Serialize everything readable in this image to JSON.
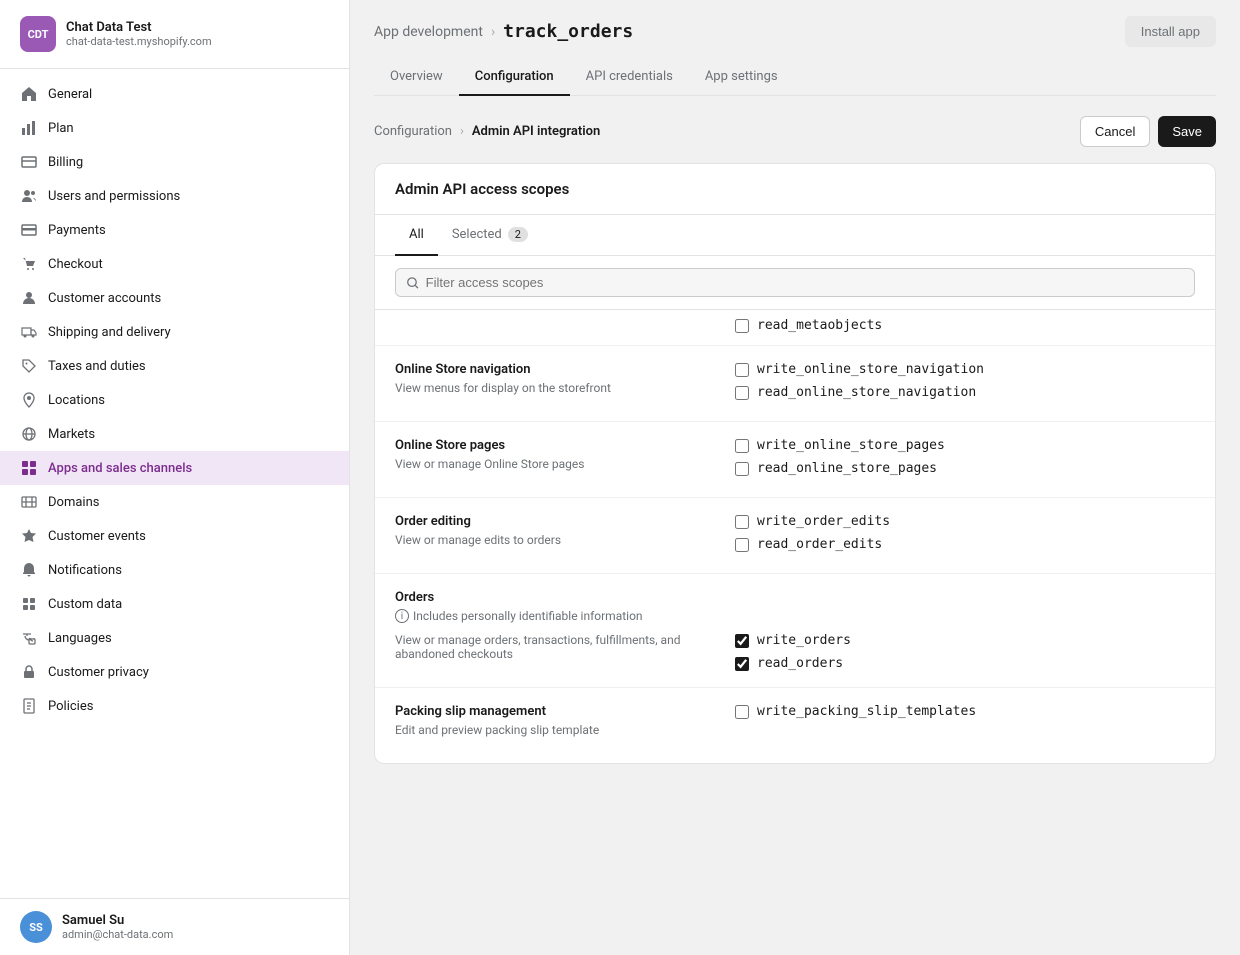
{
  "sidebar": {
    "store": {
      "initials": "CDT",
      "name": "Chat Data Test",
      "url": "chat-data-test.myshopify.com"
    },
    "nav_items": [
      {
        "id": "general",
        "label": "General",
        "icon": "home"
      },
      {
        "id": "plan",
        "label": "Plan",
        "icon": "chart"
      },
      {
        "id": "billing",
        "label": "Billing",
        "icon": "billing"
      },
      {
        "id": "users",
        "label": "Users and permissions",
        "icon": "users"
      },
      {
        "id": "payments",
        "label": "Payments",
        "icon": "payments"
      },
      {
        "id": "checkout",
        "label": "Checkout",
        "icon": "cart"
      },
      {
        "id": "customer-accounts",
        "label": "Customer accounts",
        "icon": "person"
      },
      {
        "id": "shipping",
        "label": "Shipping and delivery",
        "icon": "truck"
      },
      {
        "id": "taxes",
        "label": "Taxes and duties",
        "icon": "tag"
      },
      {
        "id": "locations",
        "label": "Locations",
        "icon": "pin"
      },
      {
        "id": "markets",
        "label": "Markets",
        "icon": "globe"
      },
      {
        "id": "apps",
        "label": "Apps and sales channels",
        "icon": "apps",
        "active": true
      },
      {
        "id": "domains",
        "label": "Domains",
        "icon": "domain"
      },
      {
        "id": "customer-events",
        "label": "Customer events",
        "icon": "events"
      },
      {
        "id": "notifications",
        "label": "Notifications",
        "icon": "bell"
      },
      {
        "id": "custom-data",
        "label": "Custom data",
        "icon": "data"
      },
      {
        "id": "languages",
        "label": "Languages",
        "icon": "language"
      },
      {
        "id": "customer-privacy",
        "label": "Customer privacy",
        "icon": "lock"
      },
      {
        "id": "policies",
        "label": "Policies",
        "icon": "doc"
      }
    ],
    "user": {
      "initials": "SS",
      "name": "Samuel Su",
      "email": "admin@chat-data.com"
    }
  },
  "header": {
    "breadcrumb_parent": "App development",
    "breadcrumb_current": "track_orders",
    "install_button": "Install app"
  },
  "tabs": [
    {
      "id": "overview",
      "label": "Overview"
    },
    {
      "id": "configuration",
      "label": "Configuration",
      "active": true
    },
    {
      "id": "api-credentials",
      "label": "API credentials"
    },
    {
      "id": "app-settings",
      "label": "App settings"
    }
  ],
  "sub_breadcrumb": {
    "parent": "Configuration",
    "current": "Admin API integration"
  },
  "actions": {
    "cancel": "Cancel",
    "save": "Save"
  },
  "card": {
    "title": "Admin API access scopes",
    "scope_tabs": [
      {
        "id": "all",
        "label": "All",
        "active": true
      },
      {
        "id": "selected",
        "label": "Selected",
        "badge": "2"
      }
    ],
    "filter_placeholder": "Filter access scopes",
    "sections": [
      {
        "id": "top-partial",
        "items_right": [
          {
            "id": "read_metaobjects",
            "label": "read_metaobjects",
            "checked": false
          }
        ]
      },
      {
        "id": "online-store-nav",
        "title": "Online Store navigation",
        "desc": "View menus for display on the storefront",
        "items": [
          {
            "id": "write_online_store_navigation",
            "label": "write_online_store_navigation",
            "checked": false
          },
          {
            "id": "read_online_store_navigation",
            "label": "read_online_store_navigation",
            "checked": false
          }
        ]
      },
      {
        "id": "online-store-pages",
        "title": "Online Store pages",
        "desc": "View or manage Online Store pages",
        "items": [
          {
            "id": "write_online_store_pages",
            "label": "write_online_store_pages",
            "checked": false
          },
          {
            "id": "read_online_store_pages",
            "label": "read_online_store_pages",
            "checked": false
          }
        ]
      },
      {
        "id": "order-editing",
        "title": "Order editing",
        "desc": "View or manage edits to orders",
        "items": [
          {
            "id": "write_order_edits",
            "label": "write_order_edits",
            "checked": false
          },
          {
            "id": "read_order_edits",
            "label": "read_order_edits",
            "checked": false
          }
        ]
      },
      {
        "id": "orders",
        "title": "Orders",
        "info": "Includes personally identifiable information",
        "desc": "View or manage orders, transactions, fulfillments, and abandoned checkouts",
        "items": [
          {
            "id": "write_orders",
            "label": "write_orders",
            "checked": true
          },
          {
            "id": "read_orders",
            "label": "read_orders",
            "checked": true
          }
        ]
      },
      {
        "id": "packing-slip",
        "title": "Packing slip management",
        "desc": "Edit and preview packing slip template",
        "items": [
          {
            "id": "write_packing_slip_templates",
            "label": "write_packing_slip_templates",
            "checked": false
          }
        ]
      }
    ]
  }
}
